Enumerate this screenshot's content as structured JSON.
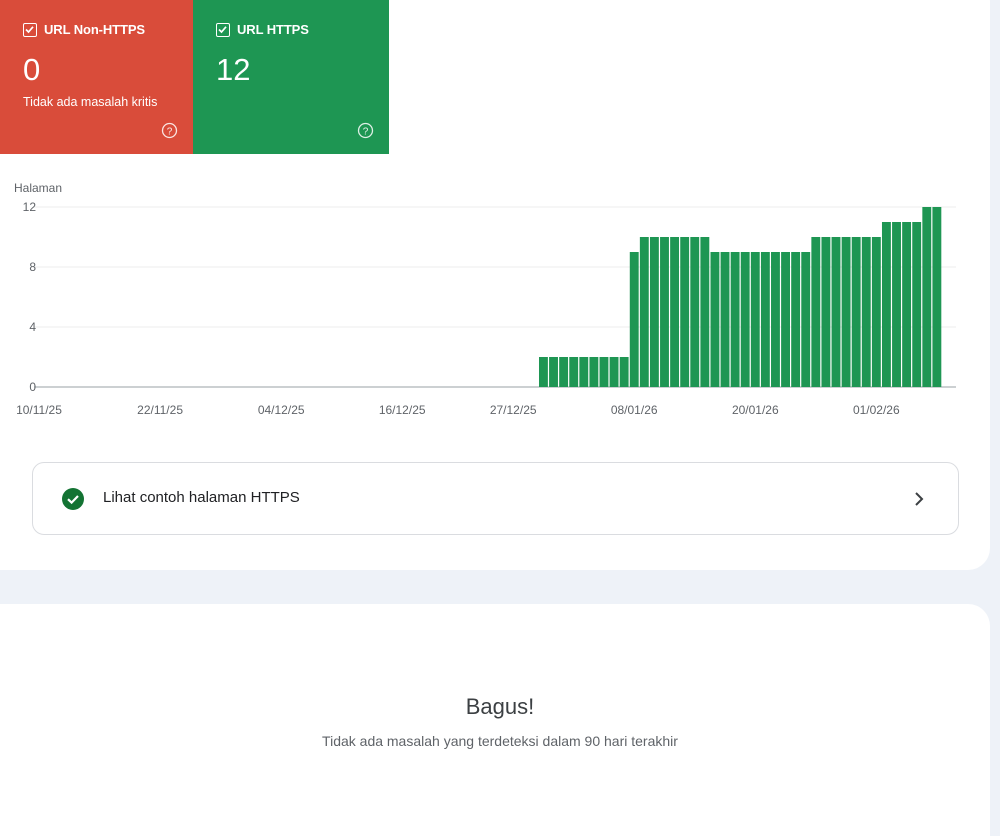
{
  "tiles": {
    "non_https": {
      "label": "URL Non-HTTPS",
      "count": "0",
      "description": "Tidak ada masalah kritis",
      "color": "#d94c3a"
    },
    "https": {
      "label": "URL HTTPS",
      "count": "12",
      "color": "#1e9653"
    }
  },
  "chart_data": {
    "type": "bar",
    "ylabel": "Halaman",
    "ylim": [
      0,
      12
    ],
    "yticks": [
      "0",
      "4",
      "8",
      "12"
    ],
    "xtick_labels": [
      "10/11/25",
      "22/11/25",
      "04/12/25",
      "16/12/25",
      "27/12/25",
      "08/01/26",
      "20/01/26",
      "01/02/26"
    ],
    "start_date": "2025-11-10",
    "end_date": "2026-02-09",
    "series": [
      {
        "color": "#1e9653",
        "points": [
          {
            "from": "2025-12-30",
            "to": "2026-01-07",
            "value": 2
          },
          {
            "from": "2026-01-08",
            "to": "2026-01-08",
            "value": 9
          },
          {
            "from": "2026-01-09",
            "to": "2026-01-15",
            "value": 10
          },
          {
            "from": "2026-01-16",
            "to": "2026-01-25",
            "value": 9
          },
          {
            "from": "2026-01-26",
            "to": "2026-02-01",
            "value": 10
          },
          {
            "from": "2026-02-02",
            "to": "2026-02-05",
            "value": 11
          },
          {
            "from": "2026-02-06",
            "to": "2026-02-07",
            "value": 12
          }
        ]
      }
    ],
    "grid": true
  },
  "example_card": {
    "label": "Lihat contoh halaman HTTPS"
  },
  "status": {
    "title": "Bagus!",
    "subtitle": "Tidak ada masalah yang terdeteksi dalam 90 hari terakhir"
  }
}
